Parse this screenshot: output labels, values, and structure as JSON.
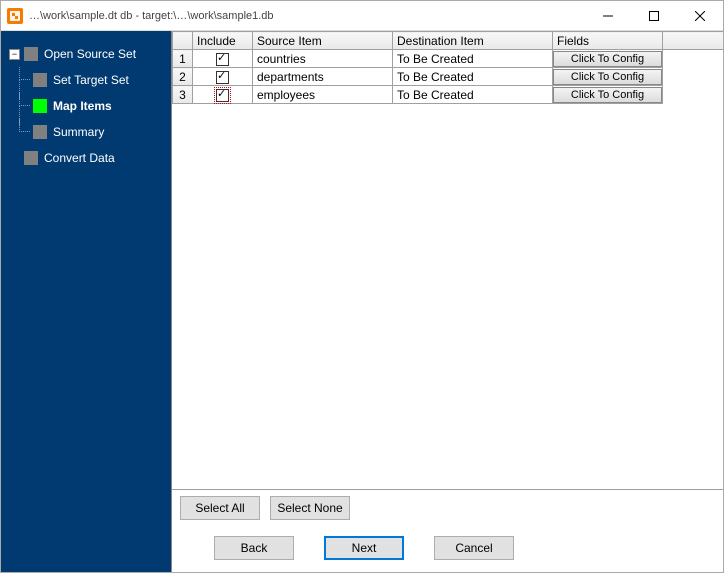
{
  "window": {
    "title": "…\\work\\sample.dt  db - target:\\…\\work\\sample1.db"
  },
  "sidebar": {
    "items": [
      {
        "label": "Open Source Set",
        "active": false,
        "child": false
      },
      {
        "label": "Set Target Set",
        "active": false,
        "child": true
      },
      {
        "label": "Map Items",
        "active": true,
        "child": true
      },
      {
        "label": "Summary",
        "active": false,
        "child": true
      },
      {
        "label": "Convert Data",
        "active": false,
        "child": false
      }
    ]
  },
  "grid": {
    "headers": {
      "include": "Include",
      "source": "Source Item",
      "dest": "Destination Item",
      "fields": "Fields"
    },
    "config_label": "Click To Config",
    "rows": [
      {
        "n": "1",
        "include": true,
        "source": "countries",
        "dest": "To Be Created"
      },
      {
        "n": "2",
        "include": true,
        "source": "departments",
        "dest": "To Be Created"
      },
      {
        "n": "3",
        "include": true,
        "source": "employees",
        "dest": "To Be Created"
      }
    ]
  },
  "buttons": {
    "select_all": "Select All",
    "select_none": "Select None",
    "back": "Back",
    "next": "Next",
    "cancel": "Cancel"
  }
}
